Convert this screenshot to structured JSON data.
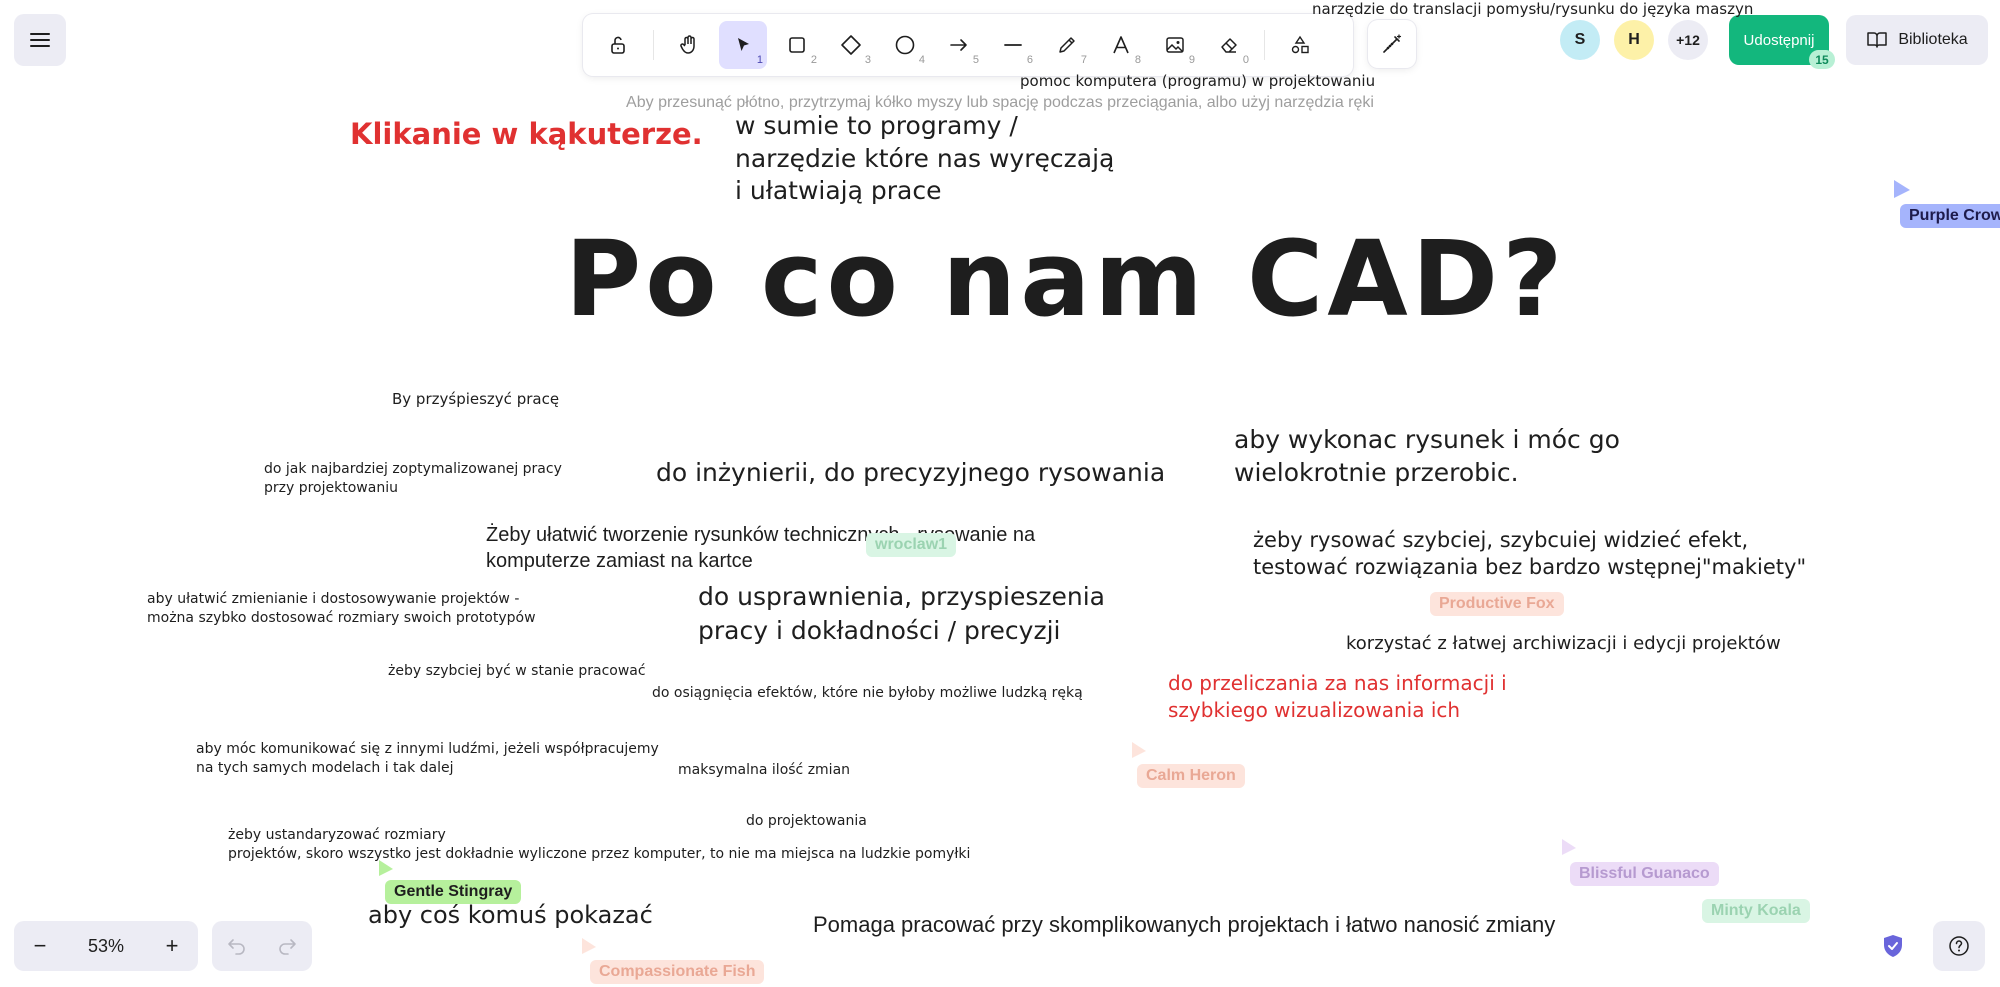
{
  "toolbar": {
    "hint": "Aby przesunąć płótno, przytrzymaj kółko myszy lub spację podczas przeciągania, albo użyj narzędzia ręki",
    "tools": [
      {
        "name": "lock",
        "num": ""
      },
      {
        "name": "hand",
        "num": ""
      },
      {
        "name": "selection",
        "num": "1"
      },
      {
        "name": "rectangle",
        "num": "2"
      },
      {
        "name": "diamond",
        "num": "3"
      },
      {
        "name": "ellipse",
        "num": "4"
      },
      {
        "name": "arrow",
        "num": "5"
      },
      {
        "name": "line",
        "num": "6"
      },
      {
        "name": "draw",
        "num": "7"
      },
      {
        "name": "text",
        "num": "8"
      },
      {
        "name": "image",
        "num": "9"
      },
      {
        "name": "eraser",
        "num": "0"
      }
    ]
  },
  "collab": {
    "avatars": [
      {
        "initial": "S",
        "color": "#c3ecf5"
      },
      {
        "initial": "H",
        "color": "#fdf1a8"
      },
      {
        "initial": "+12",
        "color": "#ececf4"
      }
    ],
    "share_label": "Udostępnij",
    "share_count": "15",
    "library_label": "Biblioteka"
  },
  "zoom": {
    "minus": "−",
    "value": "53%",
    "plus": "+"
  },
  "canvas": {
    "title": "Po co nam CAD?",
    "notes": {
      "top_right": "narzędzie do translacji pomysłu/rysunku do języka maszyn",
      "top_center": "pomoc komputera (programu) w projektowaniu",
      "red_clicking": "Klikanie w kąkuterze.",
      "programs": "w sumie to programy /\nnarzędzie które nas wyręczają\ni ułatwiają prace",
      "speed_up": "By przyśpieszyć pracę",
      "optimized": "do jak najbardziej zoptymalizowanej pracy\nprzy projektowaniu",
      "engineering": "do inżynierii, do precyzyjnego rysowania",
      "redraw": "aby wykonac rysunek i móc go\nwielokrotnie przerobic.",
      "tech_drawings": "Żeby ułatwić tworzenie rysunków technicznych - rysowanie na\nkomputerze zamiast na kartce",
      "faster_draw": "żeby rysować szybciej, szybcuiej widzieć efekt,\ntestować rozwiązania bez bardzo wstępnej\"makiety\"",
      "adapt": "aby ułatwić zmienianie i dostosowywanie projektów -\nmożna szybko dostosować rozmiary swoich prototypów",
      "improve": "do usprawnienia, przyspieszenia\npracy i dokładności / precyzji",
      "archive": "korzystać z łatwej archiwizacji i edycji projektów",
      "red_compute": "do przeliczania za nas informacji i\nszybkiego wizualizowania ich",
      "work_faster": "żeby szybciej być w stanie pracować",
      "effects": "do osiągnięcia efektów, które nie byłoby możliwe ludzką ręką",
      "communicate": "aby móc komunikować się z innymi ludźmi, jeżeli współpracujemy\nna tych samych modelach i tak dalej",
      "max_changes": "maksymalna ilość zmian",
      "designing": "do projektowania",
      "standardize": "żeby ustandaryzować rozmiary\nprojektów, skoro wszystko jest dokładnie wyliczone przez komputer, to nie ma miejsca na ludzkie pomyłki",
      "show": "aby coś komuś pokazać",
      "complex": "Pomaga pracować przy skomplikowanych projektach i łatwo nanosić zmiany"
    }
  },
  "cursors": [
    {
      "label": "Purple Crow",
      "bg": "#a5b4fc",
      "fg": "#1e1b4b"
    },
    {
      "label": "wroclaw1",
      "bg": "#d9f5e4",
      "fg": "#9bd3b1"
    },
    {
      "label": "Productive Fox",
      "bg": "#fde4dc",
      "fg": "#e9a895"
    },
    {
      "label": "Calm Heron",
      "bg": "#fde4dc",
      "fg": "#e9a895"
    },
    {
      "label": "Gentle Stingray",
      "bg": "#b6f09c",
      "fg": "#1e1e1e"
    },
    {
      "label": "Blissful Guanaco",
      "bg": "#ecdcf7",
      "fg": "#b69ad0"
    },
    {
      "label": "Minty Koala",
      "bg": "#d9f5e4",
      "fg": "#9bd3b1"
    },
    {
      "label": "Compassionate Fish",
      "bg": "#fde4dc",
      "fg": "#e9a895"
    }
  ]
}
